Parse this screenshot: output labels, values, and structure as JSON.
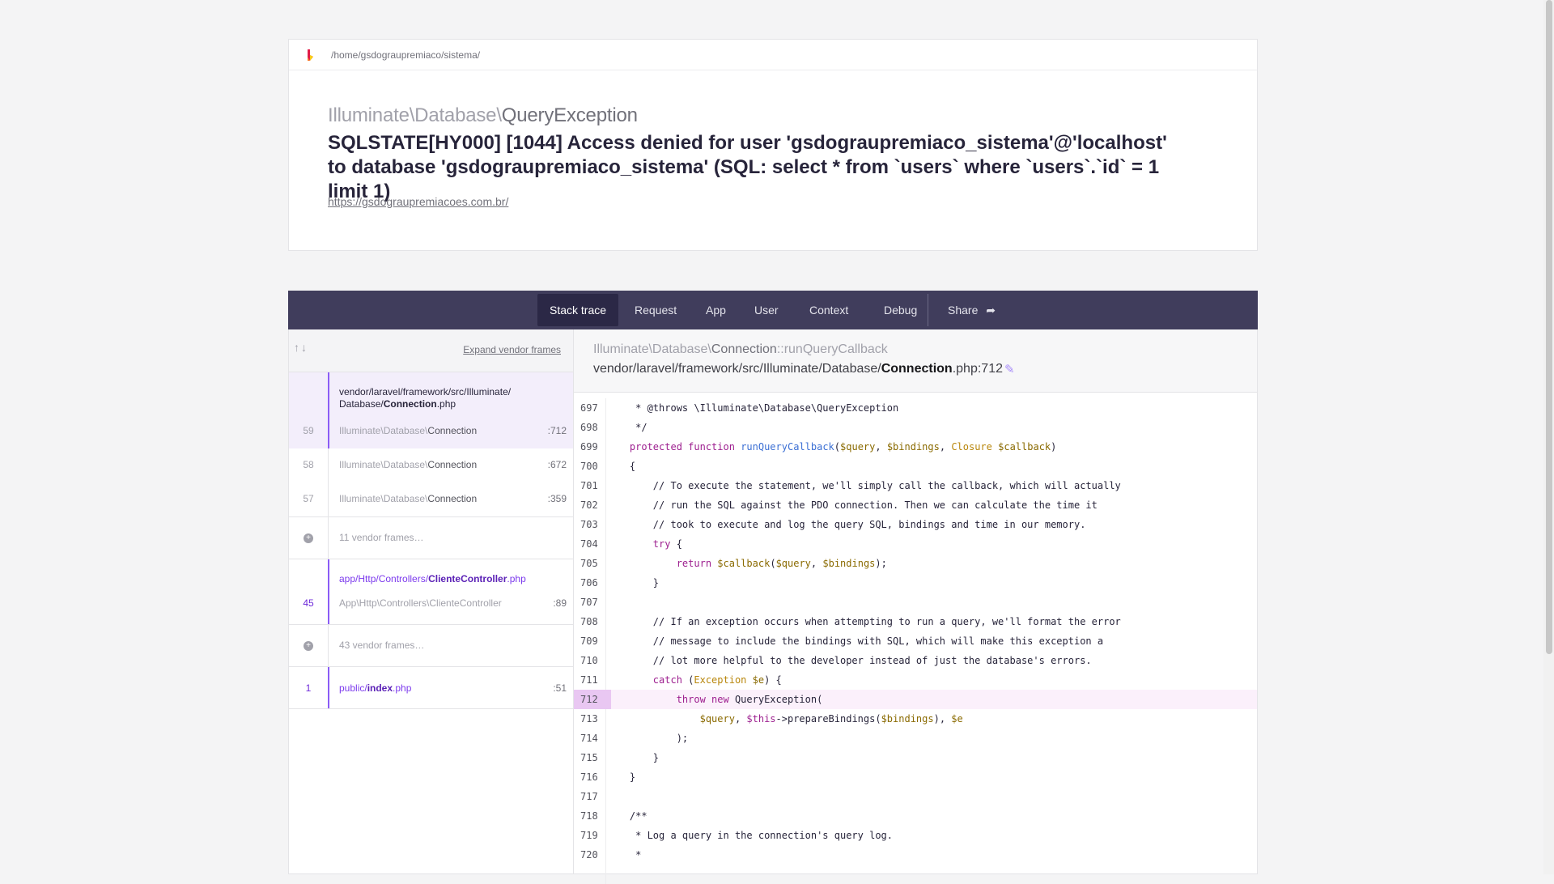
{
  "header": {
    "path": "/home/gsdograupremiaco/sistema/",
    "exception_namespace": "Illuminate\\Database\\",
    "exception_class": "QueryException",
    "message": "SQLSTATE[HY000] [1044] Access denied for user 'gsdograupremiaco_sistema'@'localhost' to database 'gsdograupremiaco_sistema' (SQL: select * from `users` where `users`.`id` = 1 limit 1)",
    "url": "https://gsdograupremiacoes.com.br/"
  },
  "tabs": {
    "stack_trace": "Stack trace",
    "request": "Request",
    "app": "App",
    "user": "User",
    "context": "Context",
    "debug": "Debug",
    "share": "Share"
  },
  "frames": {
    "arrows": "↑↓",
    "expand_label": "Expand vendor frames",
    "group1": {
      "file_prefix": "vendor/laravel/framework/src/Illuminate/",
      "file_dir2": "Database/",
      "file_name": "Connection",
      "file_ext": ".php",
      "items": [
        {
          "num": "59",
          "ns": "Illuminate\\Database\\",
          "cls": "Connection",
          "line": ":712"
        },
        {
          "num": "58",
          "ns": "Illuminate\\Database\\",
          "cls": "Connection",
          "line": ":672"
        },
        {
          "num": "57",
          "ns": "Illuminate\\Database\\",
          "cls": "Connection",
          "line": ":359"
        }
      ]
    },
    "vendor1": "11 vendor frames…",
    "group2": {
      "file_prefix": "app/Http/Controllers/",
      "file_name": "ClienteController",
      "file_ext": ".php",
      "num": "45",
      "cls": "App\\Http\\Controllers\\ClienteController",
      "line": ":89"
    },
    "vendor2": "43 vendor frames…",
    "group3": {
      "file_prefix": "public/",
      "file_name": "index",
      "file_ext": ".php",
      "num": "1",
      "line": ":51"
    }
  },
  "code_header": {
    "namespace": "Illuminate\\Database\\",
    "cls": "Connection",
    "method": "::runQueryCallback",
    "file_path": "vendor/laravel/framework/src/Illuminate/Database/",
    "file_name": "Connection",
    "file_suffix": ".php:712"
  },
  "code": {
    "line_numbers": [
      "697",
      "698",
      "699",
      "700",
      "701",
      "702",
      "703",
      "704",
      "705",
      "706",
      "707",
      "708",
      "709",
      "710",
      "711",
      "712",
      "713",
      "714",
      "715",
      "716",
      "717",
      "718",
      "719",
      "720"
    ],
    "highlighted_line": "712"
  },
  "colors": {
    "accent": "#8b5cf6",
    "tabbar": "#403d5c",
    "tab_active": "#2b2846"
  }
}
